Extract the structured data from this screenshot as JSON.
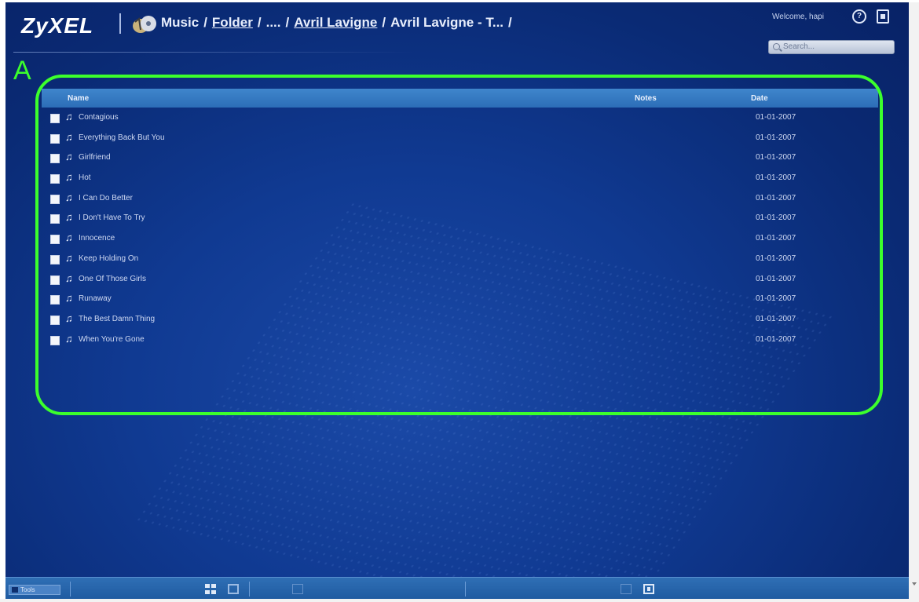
{
  "header": {
    "logo": "ZyXEL",
    "breadcrumb": [
      {
        "label": "Music",
        "link": false
      },
      {
        "label": "Folder",
        "link": true
      },
      {
        "label": "....",
        "link": false
      },
      {
        "label": "Avril Lavigne",
        "link": true
      },
      {
        "label": "Avril Lavigne - T...",
        "link": false
      }
    ],
    "trailing_slash": "/",
    "welcome": "Welcome, hapi",
    "help_icon": "?",
    "search_placeholder": "Search..."
  },
  "annotation": {
    "letter": "A",
    "color": "#3cff2c"
  },
  "table": {
    "columns": {
      "name": "Name",
      "notes": "Notes",
      "date": "Date"
    },
    "rows": [
      {
        "title": "Contagious",
        "date": "01-01-2007"
      },
      {
        "title": "Everything Back But You",
        "date": "01-01-2007"
      },
      {
        "title": "Girlfriend",
        "date": "01-01-2007"
      },
      {
        "title": "Hot",
        "date": "01-01-2007"
      },
      {
        "title": "I Can Do Better",
        "date": "01-01-2007"
      },
      {
        "title": "I Don't Have To Try",
        "date": "01-01-2007"
      },
      {
        "title": "Innocence",
        "date": "01-01-2007"
      },
      {
        "title": "Keep Holding On",
        "date": "01-01-2007"
      },
      {
        "title": "One Of Those Girls",
        "date": "01-01-2007"
      },
      {
        "title": "Runaway",
        "date": "01-01-2007"
      },
      {
        "title": "The Best Damn Thing",
        "date": "01-01-2007"
      },
      {
        "title": "When You're Gone",
        "date": "01-01-2007"
      }
    ]
  },
  "bottombar": {
    "left_button": "Tools",
    "icons": [
      "grid-view-icon",
      "list-view-icon",
      "page-icon",
      "disabled-icon",
      "next-icon"
    ]
  },
  "colors": {
    "background": "#103a92",
    "header_row": "#3f86cc",
    "bottom_bar": "#2f6fb5",
    "annotation": "#3cff2c"
  }
}
